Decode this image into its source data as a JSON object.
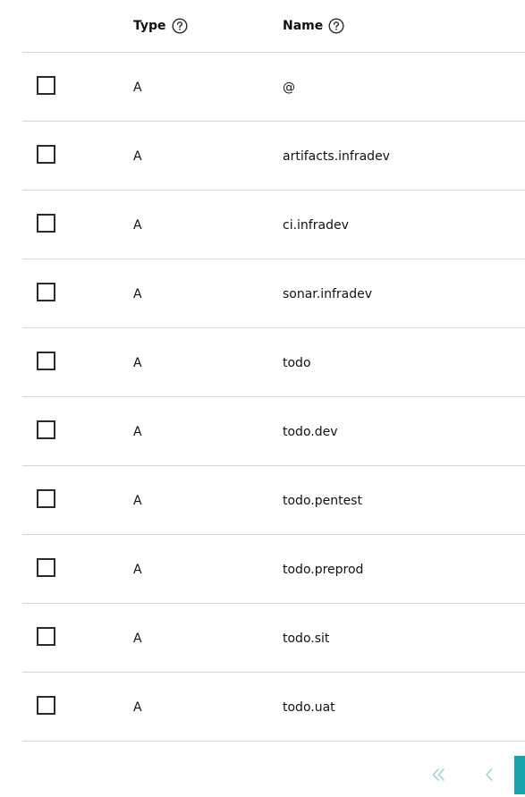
{
  "table": {
    "headers": {
      "type": "Type",
      "name": "Name"
    },
    "rows": [
      {
        "type": "A",
        "name": "@"
      },
      {
        "type": "A",
        "name": "artifacts.infradev"
      },
      {
        "type": "A",
        "name": "ci.infradev"
      },
      {
        "type": "A",
        "name": "sonar.infradev"
      },
      {
        "type": "A",
        "name": "todo"
      },
      {
        "type": "A",
        "name": "todo.dev"
      },
      {
        "type": "A",
        "name": "todo.pentest"
      },
      {
        "type": "A",
        "name": "todo.preprod"
      },
      {
        "type": "A",
        "name": "todo.sit"
      },
      {
        "type": "A",
        "name": "todo.uat"
      }
    ]
  },
  "pagination": {
    "icons": [
      "double-chevron-left-icon",
      "chevron-left-icon"
    ],
    "accent_color": "#1ba3ad",
    "disabled_icon_color": "#9fd3d8"
  }
}
